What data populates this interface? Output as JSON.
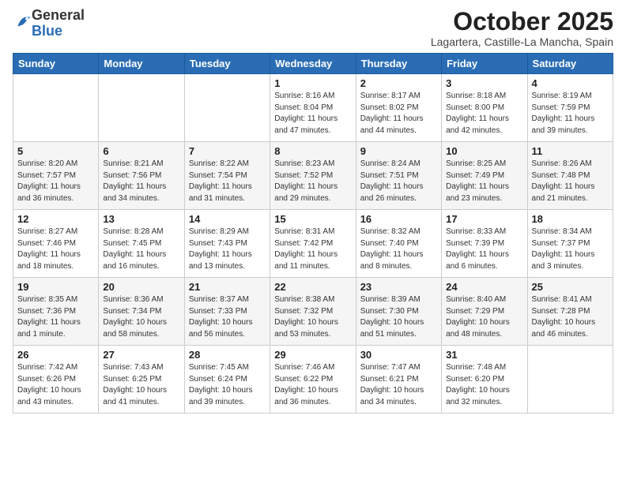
{
  "logo": {
    "general": "General",
    "blue": "Blue"
  },
  "header": {
    "month": "October 2025",
    "location": "Lagartera, Castille-La Mancha, Spain"
  },
  "days_of_week": [
    "Sunday",
    "Monday",
    "Tuesday",
    "Wednesday",
    "Thursday",
    "Friday",
    "Saturday"
  ],
  "weeks": [
    [
      {
        "day": "",
        "info": ""
      },
      {
        "day": "",
        "info": ""
      },
      {
        "day": "",
        "info": ""
      },
      {
        "day": "1",
        "info": "Sunrise: 8:16 AM\nSunset: 8:04 PM\nDaylight: 11 hours\nand 47 minutes."
      },
      {
        "day": "2",
        "info": "Sunrise: 8:17 AM\nSunset: 8:02 PM\nDaylight: 11 hours\nand 44 minutes."
      },
      {
        "day": "3",
        "info": "Sunrise: 8:18 AM\nSunset: 8:00 PM\nDaylight: 11 hours\nand 42 minutes."
      },
      {
        "day": "4",
        "info": "Sunrise: 8:19 AM\nSunset: 7:59 PM\nDaylight: 11 hours\nand 39 minutes."
      }
    ],
    [
      {
        "day": "5",
        "info": "Sunrise: 8:20 AM\nSunset: 7:57 PM\nDaylight: 11 hours\nand 36 minutes."
      },
      {
        "day": "6",
        "info": "Sunrise: 8:21 AM\nSunset: 7:56 PM\nDaylight: 11 hours\nand 34 minutes."
      },
      {
        "day": "7",
        "info": "Sunrise: 8:22 AM\nSunset: 7:54 PM\nDaylight: 11 hours\nand 31 minutes."
      },
      {
        "day": "8",
        "info": "Sunrise: 8:23 AM\nSunset: 7:52 PM\nDaylight: 11 hours\nand 29 minutes."
      },
      {
        "day": "9",
        "info": "Sunrise: 8:24 AM\nSunset: 7:51 PM\nDaylight: 11 hours\nand 26 minutes."
      },
      {
        "day": "10",
        "info": "Sunrise: 8:25 AM\nSunset: 7:49 PM\nDaylight: 11 hours\nand 23 minutes."
      },
      {
        "day": "11",
        "info": "Sunrise: 8:26 AM\nSunset: 7:48 PM\nDaylight: 11 hours\nand 21 minutes."
      }
    ],
    [
      {
        "day": "12",
        "info": "Sunrise: 8:27 AM\nSunset: 7:46 PM\nDaylight: 11 hours\nand 18 minutes."
      },
      {
        "day": "13",
        "info": "Sunrise: 8:28 AM\nSunset: 7:45 PM\nDaylight: 11 hours\nand 16 minutes."
      },
      {
        "day": "14",
        "info": "Sunrise: 8:29 AM\nSunset: 7:43 PM\nDaylight: 11 hours\nand 13 minutes."
      },
      {
        "day": "15",
        "info": "Sunrise: 8:31 AM\nSunset: 7:42 PM\nDaylight: 11 hours\nand 11 minutes."
      },
      {
        "day": "16",
        "info": "Sunrise: 8:32 AM\nSunset: 7:40 PM\nDaylight: 11 hours\nand 8 minutes."
      },
      {
        "day": "17",
        "info": "Sunrise: 8:33 AM\nSunset: 7:39 PM\nDaylight: 11 hours\nand 6 minutes."
      },
      {
        "day": "18",
        "info": "Sunrise: 8:34 AM\nSunset: 7:37 PM\nDaylight: 11 hours\nand 3 minutes."
      }
    ],
    [
      {
        "day": "19",
        "info": "Sunrise: 8:35 AM\nSunset: 7:36 PM\nDaylight: 11 hours\nand 1 minute."
      },
      {
        "day": "20",
        "info": "Sunrise: 8:36 AM\nSunset: 7:34 PM\nDaylight: 10 hours\nand 58 minutes."
      },
      {
        "day": "21",
        "info": "Sunrise: 8:37 AM\nSunset: 7:33 PM\nDaylight: 10 hours\nand 56 minutes."
      },
      {
        "day": "22",
        "info": "Sunrise: 8:38 AM\nSunset: 7:32 PM\nDaylight: 10 hours\nand 53 minutes."
      },
      {
        "day": "23",
        "info": "Sunrise: 8:39 AM\nSunset: 7:30 PM\nDaylight: 10 hours\nand 51 minutes."
      },
      {
        "day": "24",
        "info": "Sunrise: 8:40 AM\nSunset: 7:29 PM\nDaylight: 10 hours\nand 48 minutes."
      },
      {
        "day": "25",
        "info": "Sunrise: 8:41 AM\nSunset: 7:28 PM\nDaylight: 10 hours\nand 46 minutes."
      }
    ],
    [
      {
        "day": "26",
        "info": "Sunrise: 7:42 AM\nSunset: 6:26 PM\nDaylight: 10 hours\nand 43 minutes."
      },
      {
        "day": "27",
        "info": "Sunrise: 7:43 AM\nSunset: 6:25 PM\nDaylight: 10 hours\nand 41 minutes."
      },
      {
        "day": "28",
        "info": "Sunrise: 7:45 AM\nSunset: 6:24 PM\nDaylight: 10 hours\nand 39 minutes."
      },
      {
        "day": "29",
        "info": "Sunrise: 7:46 AM\nSunset: 6:22 PM\nDaylight: 10 hours\nand 36 minutes."
      },
      {
        "day": "30",
        "info": "Sunrise: 7:47 AM\nSunset: 6:21 PM\nDaylight: 10 hours\nand 34 minutes."
      },
      {
        "day": "31",
        "info": "Sunrise: 7:48 AM\nSunset: 6:20 PM\nDaylight: 10 hours\nand 32 minutes."
      },
      {
        "day": "",
        "info": ""
      }
    ]
  ]
}
